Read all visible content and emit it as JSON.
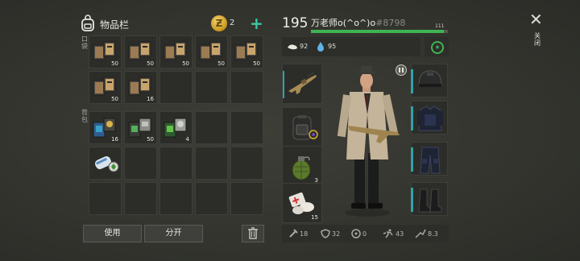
{
  "inventory": {
    "title": "物品栏",
    "currency_count": "2",
    "pocket_label": "口袋",
    "backpack_label": "背包",
    "pocket_slots": [
      {
        "item": "notebook",
        "qty": "50"
      },
      {
        "item": "notebook",
        "qty": "50"
      },
      {
        "item": "notebook",
        "qty": "50"
      },
      {
        "item": "notebook",
        "qty": "50"
      },
      {
        "item": "notebook",
        "qty": "50"
      },
      {
        "item": "notebook",
        "qty": "50"
      },
      {
        "item": "notebook",
        "qty": "16"
      },
      {
        "item": "",
        "qty": ""
      },
      {
        "item": "",
        "qty": ""
      },
      {
        "item": "",
        "qty": ""
      }
    ],
    "backpack_slots": [
      {
        "item": "blue-kit",
        "qty": "16"
      },
      {
        "item": "gray-kit",
        "qty": "50"
      },
      {
        "item": "green-kit",
        "qty": "4"
      },
      {
        "item": "",
        "qty": ""
      },
      {
        "item": "",
        "qty": ""
      },
      {
        "item": "blueprint",
        "qty": ""
      },
      {
        "item": "",
        "qty": ""
      },
      {
        "item": "",
        "qty": ""
      },
      {
        "item": "",
        "qty": ""
      },
      {
        "item": "",
        "qty": ""
      },
      {
        "item": "",
        "qty": ""
      },
      {
        "item": "",
        "qty": ""
      },
      {
        "item": "",
        "qty": ""
      },
      {
        "item": "",
        "qty": ""
      },
      {
        "item": "",
        "qty": ""
      }
    ],
    "use_label": "使用",
    "split_label": "分开"
  },
  "player": {
    "level": "195",
    "name": "万老师o(^o^)o",
    "id": "#8798",
    "xp_value": "111",
    "xp_fraction": 0.97,
    "food": "92",
    "water": "95"
  },
  "equipment": {
    "weapon_slots": [
      {
        "item": "assault-rifle",
        "qty": ""
      },
      {
        "item": "backpack",
        "qty": ""
      },
      {
        "item": "grenade",
        "qty": "3"
      },
      {
        "item": "bandage",
        "qty": "15"
      }
    ],
    "gear_slots": [
      {
        "item": "helmet"
      },
      {
        "item": "armor-vest"
      },
      {
        "item": "tactical-pants"
      },
      {
        "item": "boots"
      }
    ]
  },
  "stats": {
    "attack": "18",
    "defense": "32",
    "radiation": "0",
    "speed": "43",
    "stealth": "8.3"
  },
  "close_label": "关闭",
  "colors": {
    "accent_green": "#3fc7a4",
    "xp_green": "#3fb452",
    "slot_accent": "#2fa3a8"
  }
}
